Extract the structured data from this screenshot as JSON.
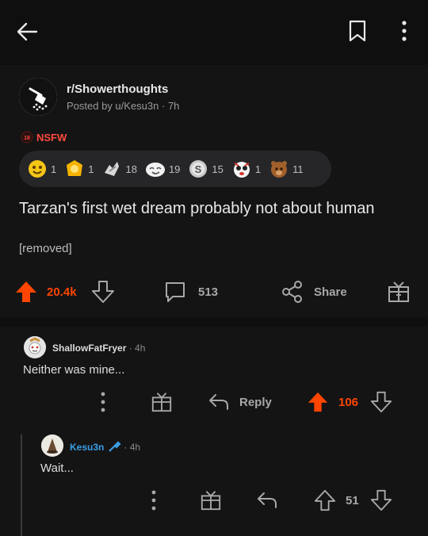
{
  "header": {
    "back_icon": "back-arrow-icon",
    "save_icon": "bookmark-icon",
    "more_icon": "more-vertical-icon"
  },
  "post": {
    "subreddit": "r/Showerthoughts",
    "posted_by": "Posted by u/Kesu3n",
    "age": "7h",
    "nsfw_label": "NSFW",
    "awards": [
      {
        "icon": "helpful-award-icon",
        "count": "1"
      },
      {
        "icon": "wholesome-award-icon",
        "count": "1"
      },
      {
        "icon": "take-my-energy-award-icon",
        "count": "18"
      },
      {
        "icon": "lol-award-icon",
        "count": "19"
      },
      {
        "icon": "silver-award-icon",
        "count": "15"
      },
      {
        "icon": "shocked-award-icon",
        "count": "1"
      },
      {
        "icon": "bravo-award-icon",
        "count": "11"
      }
    ],
    "title": "Tarzan's first wet dream probably not about human",
    "body": "[removed]",
    "upvotes": "20.4k",
    "comments": "513",
    "share_label": "Share",
    "accent": "#ff4500"
  },
  "comments": [
    {
      "user": "ShallowFatFryer",
      "time": "· 4h",
      "text": "Neither was mine...",
      "reply_label": "Reply",
      "votes": "106"
    },
    {
      "user": "Kesu3n",
      "time": "· 4h",
      "text": "Wait...",
      "votes": "51"
    }
  ]
}
